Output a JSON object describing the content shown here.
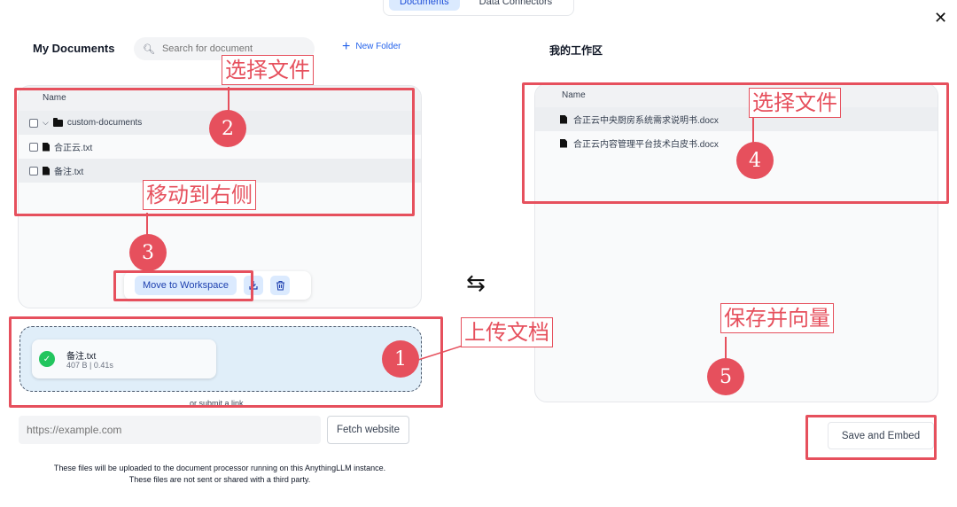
{
  "top_tabs": [
    {
      "label": "Documents",
      "active": true
    },
    {
      "label": "Data Connectors",
      "active": false
    }
  ],
  "left": {
    "title": "My Documents",
    "search_placeholder": "Search for document",
    "new_folder": "New Folder",
    "column_header": "Name",
    "rows": [
      "custom-documents",
      "合正云.txt",
      "备注.txt"
    ],
    "move_button": "Move to Workspace"
  },
  "upload": {
    "file_name": "备注.txt",
    "file_meta": "407 B | 0.41s",
    "submit_link": "or submit a link",
    "url_placeholder": "https://example.com",
    "fetch_button": "Fetch website",
    "note_line1": "These files will be uploaded to the document processor running on this AnythingLLM instance.",
    "note_line2": "These files are not sent or shared with a third party."
  },
  "right": {
    "title": "我的工作区",
    "column_header": "Name",
    "rows": [
      "合正云中央厨房系统需求说明书.docx",
      "合正云内容管理平台技术白皮书.docx"
    ],
    "save_button": "Save and Embed"
  },
  "annotations": {
    "select_file_left": "选择文件",
    "move_right": "移动到右侧",
    "upload_doc": "上传文档",
    "select_file_right": "选择文件",
    "save_vectorize": "保存并向量",
    "n1": "1",
    "n2": "2",
    "n3": "3",
    "n4": "4",
    "n5": "5"
  },
  "colors": {
    "annotation_red": "#e6505d",
    "accent_blue": "#2563eb",
    "success_green": "#22c55e"
  }
}
